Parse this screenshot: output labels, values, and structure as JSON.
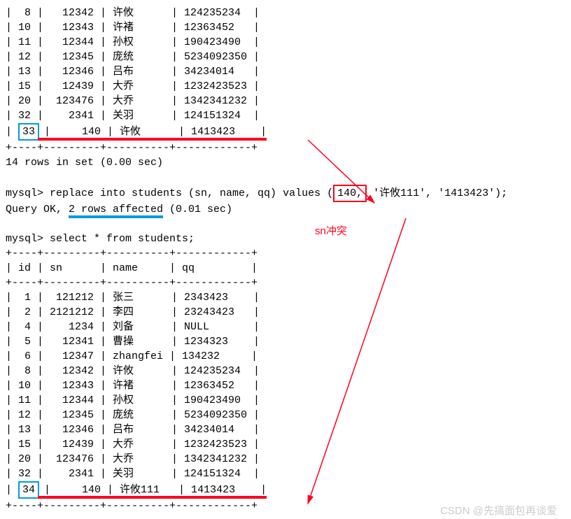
{
  "table1_rows": [
    {
      "id": "8",
      "sn": "12342",
      "name": "许攸",
      "qq": "124235234"
    },
    {
      "id": "10",
      "sn": "12343",
      "name": "许褚",
      "qq": "12363452"
    },
    {
      "id": "11",
      "sn": "12344",
      "name": "孙权",
      "qq": "190423490"
    },
    {
      "id": "12",
      "sn": "12345",
      "name": "庞统",
      "qq": "5234092350"
    },
    {
      "id": "13",
      "sn": "12346",
      "name": "吕布",
      "qq": "34234014"
    },
    {
      "id": "15",
      "sn": "12439",
      "name": "大乔",
      "qq": "1232423523"
    },
    {
      "id": "20",
      "sn": "123476",
      "name": "大乔",
      "qq": "1342341232"
    },
    {
      "id": "32",
      "sn": "2341",
      "name": "关羽",
      "qq": "124151324"
    }
  ],
  "table1_lastrow": {
    "id": "33",
    "sn": "140",
    "name": "许攸",
    "qq": "1413423"
  },
  "border_line": "+----+---------+----------+------------+",
  "result1": "14 rows in set (0.00 sec)",
  "prompt": "mysql>",
  "command1_a": " replace into students (sn, name, qq) values (",
  "command1_box": "140,",
  "command1_b": " '许攸111', '1413423');",
  "affected_prefix": "Query OK, ",
  "affected_text": "2 rows affected",
  "affected_suffix": " (0.01 sec)",
  "command2": " select * from students;",
  "header_line": "| id | sn      | name     | qq         |",
  "annotation": "sn冲突",
  "table2_rows": [
    {
      "id": "1",
      "sn": "121212",
      "name": "张三",
      "qq": "2343423"
    },
    {
      "id": "2",
      "sn": "2121212",
      "name": "李四",
      "qq": "23243423"
    },
    {
      "id": "4",
      "sn": "1234",
      "name": "刘备",
      "qq": "NULL"
    },
    {
      "id": "5",
      "sn": "12341",
      "name": "曹操",
      "qq": "1234323"
    },
    {
      "id": "6",
      "sn": "12347",
      "name": "zhangfei",
      "qq": "134232"
    },
    {
      "id": "8",
      "sn": "12342",
      "name": "许攸",
      "qq": "124235234"
    },
    {
      "id": "10",
      "sn": "12343",
      "name": "许褚",
      "qq": "12363452"
    },
    {
      "id": "11",
      "sn": "12344",
      "name": "孙权",
      "qq": "190423490"
    },
    {
      "id": "12",
      "sn": "12345",
      "name": "庞统",
      "qq": "5234092350"
    },
    {
      "id": "13",
      "sn": "12346",
      "name": "吕布",
      "qq": "34234014"
    },
    {
      "id": "15",
      "sn": "12439",
      "name": "大乔",
      "qq": "1232423523"
    },
    {
      "id": "20",
      "sn": "123476",
      "name": "大乔",
      "qq": "1342341232"
    },
    {
      "id": "32",
      "sn": "2341",
      "name": "关羽",
      "qq": "124151324"
    }
  ],
  "table2_lastrow": {
    "id": "34",
    "sn": "140",
    "name": "许攸111",
    "qq": "1413423"
  },
  "watermark": "CSDN @先搞面包再谈爱"
}
